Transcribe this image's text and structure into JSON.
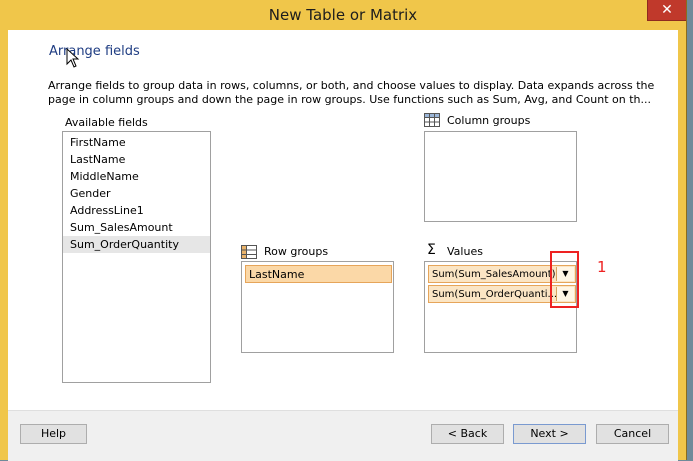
{
  "window": {
    "title": "New Table or Matrix",
    "close_glyph": "✕"
  },
  "page": {
    "heading": "Arrange fields",
    "description_lines": [
      "Arrange fields to group data in rows, columns, or both, and choose values to display. Data expands across the",
      "page in column groups and down the page in row groups.  Use functions such as Sum, Avg, and Count on th..."
    ]
  },
  "available_fields": {
    "label": "Available fields",
    "items": [
      "FirstName",
      "LastName",
      "MiddleName",
      "Gender",
      "AddressLine1",
      "Sum_SalesAmount",
      "Sum_OrderQuantity"
    ],
    "selected": "Sum_OrderQuantity"
  },
  "column_groups": {
    "label": "Column groups",
    "icon": "column-groups-icon",
    "items": []
  },
  "row_groups": {
    "label": "Row groups",
    "icon": "row-groups-icon",
    "items": [
      "LastName"
    ]
  },
  "values": {
    "label": "Values",
    "icon": "sigma-icon",
    "items": [
      "Sum(Sum_SalesAmount)",
      "Sum(Sum_OrderQuanti..."
    ]
  },
  "annotation": {
    "number": "1"
  },
  "buttons": {
    "help": "Help",
    "back": "< Back",
    "next": "Next >",
    "cancel": "Cancel"
  },
  "colors": {
    "accent": "#f0c64a",
    "annotation_red": "#e22",
    "heading_blue": "#1e3c82"
  }
}
